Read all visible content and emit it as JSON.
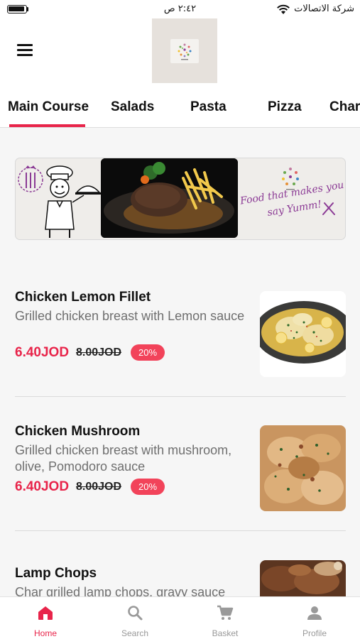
{
  "status_bar": {
    "time": "٢:٤٢ ص",
    "carrier": "شركة الاتصالات"
  },
  "header": {
    "logo_icon": "restaurant-logo"
  },
  "tabs": [
    {
      "label": "Main Course",
      "active": true
    },
    {
      "label": "Salads",
      "active": false
    },
    {
      "label": "Pasta",
      "active": false
    },
    {
      "label": "Pizza",
      "active": false
    },
    {
      "label": "Char",
      "active": false
    }
  ],
  "banner": {
    "slogan_line1": "Food that makes you",
    "slogan_line2": "say Yumm!"
  },
  "items": [
    {
      "title": "Chicken Lemon Fillet",
      "description": "Grilled chicken breast with Lemon sauce",
      "price": "6.40JOD",
      "old_price": "8.00JOD",
      "discount": "20%"
    },
    {
      "title": "Chicken Mushroom",
      "description": "Grilled chicken breast with mushroom, olive, Pomodoro sauce",
      "price": "6.40JOD",
      "old_price": "8.00JOD",
      "discount": "20%"
    },
    {
      "title": "Lamp Chops",
      "description": "Char grilled lamp chops, gravy sauce"
    }
  ],
  "bottom_nav": [
    {
      "label": "Home",
      "icon": "home-icon",
      "active": true
    },
    {
      "label": "Search",
      "icon": "search-icon",
      "active": false
    },
    {
      "label": "Basket",
      "icon": "cart-icon",
      "active": false
    },
    {
      "label": "Profile",
      "icon": "profile-icon",
      "active": false
    }
  ],
  "colors": {
    "accent": "#e8244a",
    "badge": "#f2435a",
    "slogan": "#8b3a95"
  }
}
